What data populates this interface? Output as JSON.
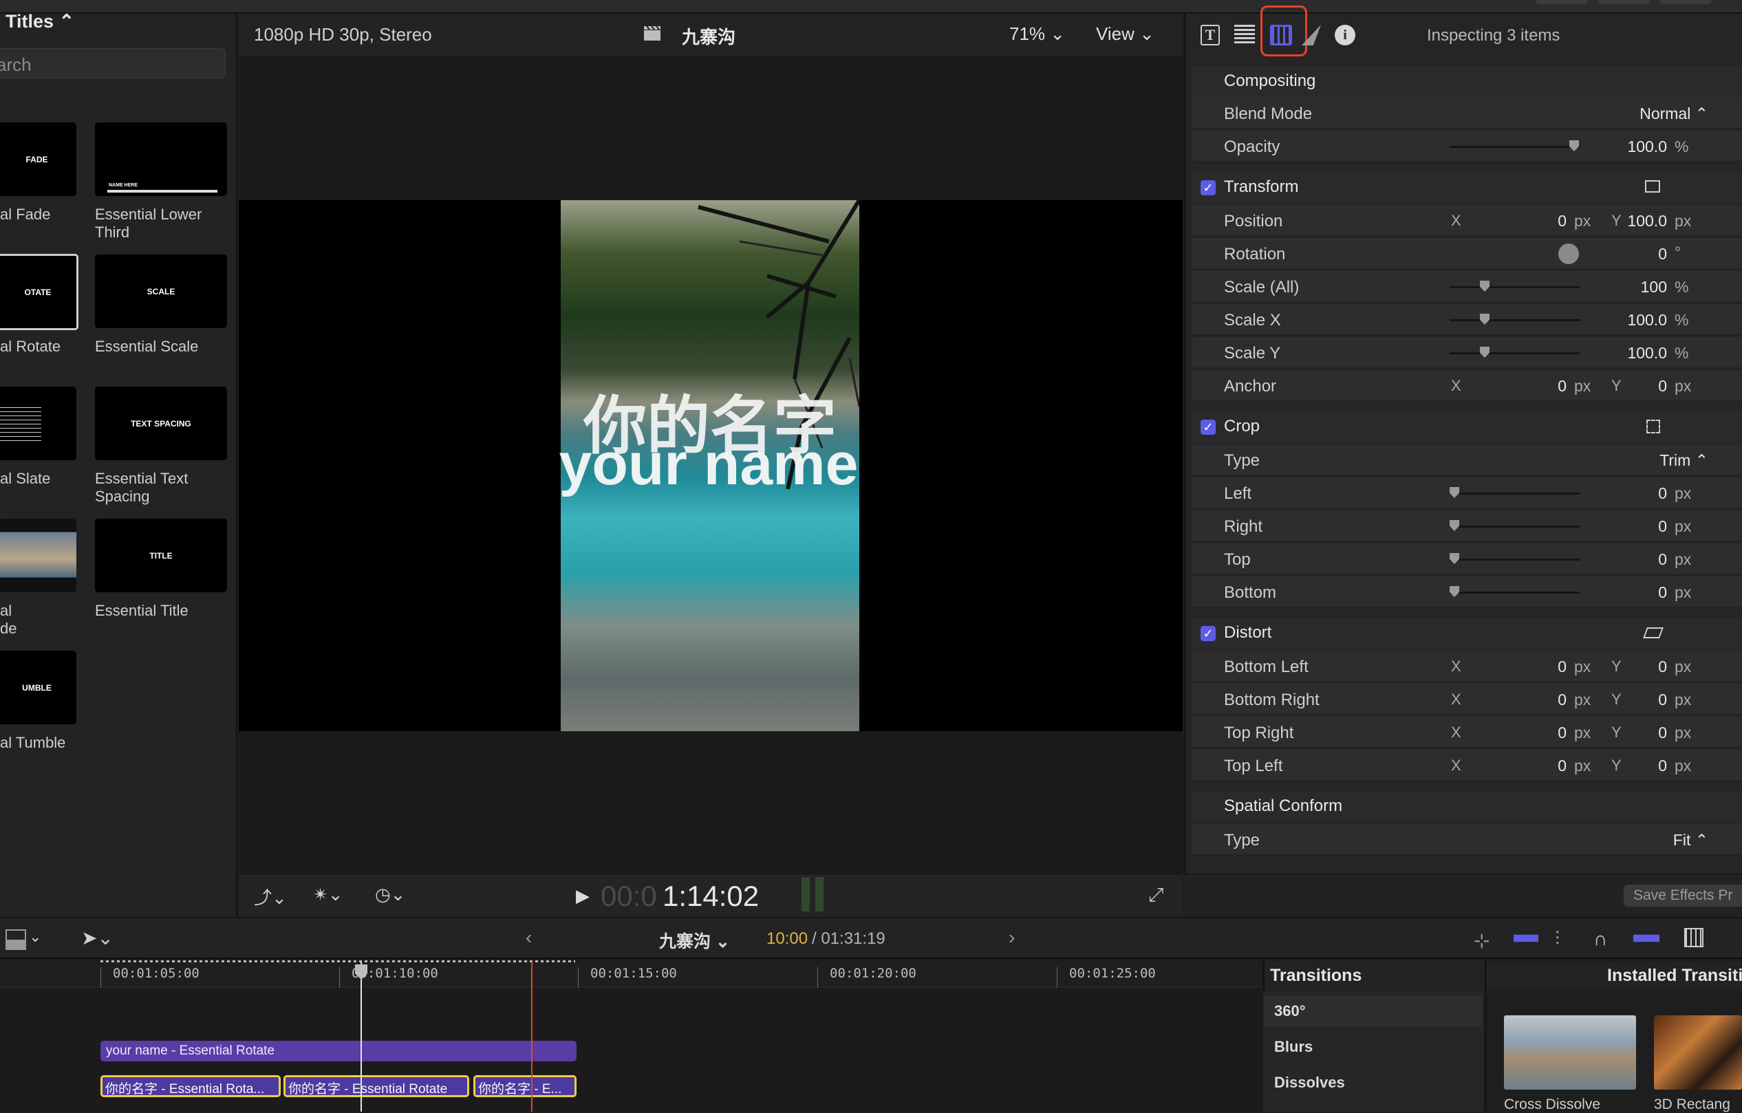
{
  "browser": {
    "title": "Titles ⌃",
    "search_placeholder": "arch",
    "items": [
      {
        "thumb": "FADE",
        "label": "al Fade"
      },
      {
        "thumb": "NAME HERE",
        "label": "Essential Lower Third"
      },
      {
        "thumb": "OTATE",
        "label": "al Rotate"
      },
      {
        "thumb": "SCALE",
        "label": "Essential Scale"
      },
      {
        "thumb": "",
        "label": "al Slate"
      },
      {
        "thumb": "TEXT SPACING",
        "label": "Essential Text Spacing"
      },
      {
        "thumb": "",
        "label": "al de"
      },
      {
        "thumb": "TITLE",
        "label": "Essential Title"
      },
      {
        "thumb": "UMBLE",
        "label": "al Tumble"
      }
    ]
  },
  "viewer": {
    "format": "1080p HD 30p, Stereo",
    "project": "九寨沟",
    "zoom": "71% ⌄",
    "view": "View ⌄",
    "title_cn": "你的名字",
    "title_en": "your name",
    "timecode_dim": "00:0",
    "timecode": "1:14:02"
  },
  "inspector": {
    "header": "Inspecting 3 items",
    "compositing": {
      "title": "Compositing",
      "blend_label": "Blend Mode",
      "blend_value": "Normal ⌃",
      "opacity_label": "Opacity",
      "opacity_value": "100.0",
      "opacity_unit": "%"
    },
    "transform": {
      "title": "Transform",
      "position": {
        "label": "Position",
        "x": "0",
        "y": "100.0"
      },
      "rotation": {
        "label": "Rotation",
        "value": "0",
        "unit": "°"
      },
      "scale_all": {
        "label": "Scale (All)",
        "value": "100"
      },
      "scale_x": {
        "label": "Scale X",
        "value": "100.0"
      },
      "scale_y": {
        "label": "Scale Y",
        "value": "100.0"
      },
      "anchor": {
        "label": "Anchor",
        "x": "0",
        "y": "0"
      }
    },
    "crop": {
      "title": "Crop",
      "type_label": "Type",
      "type_value": "Trim ⌃",
      "left": {
        "label": "Left",
        "value": "0"
      },
      "right": {
        "label": "Right",
        "value": "0"
      },
      "top": {
        "label": "Top",
        "value": "0"
      },
      "bottom": {
        "label": "Bottom",
        "value": "0"
      }
    },
    "distort": {
      "title": "Distort",
      "rows": [
        {
          "label": "Bottom Left",
          "x": "0",
          "y": "0"
        },
        {
          "label": "Bottom Right",
          "x": "0",
          "y": "0"
        },
        {
          "label": "Top Right",
          "x": "0",
          "y": "0"
        },
        {
          "label": "Top Left",
          "x": "0",
          "y": "0"
        }
      ]
    },
    "spatial": {
      "title": "Spatial Conform",
      "type_label": "Type",
      "type_value": "Fit ⌃"
    },
    "save_button": "Save Effects Pr",
    "px": "px",
    "pct": "%",
    "x_axis": "X",
    "y_axis": "Y"
  },
  "timeline": {
    "project": "九寨沟 ⌄",
    "time_current": "10:00",
    "time_total": "/ 01:31:19",
    "ruler": [
      "00:01:05:00",
      "00:01:10:00",
      "00:01:15:00",
      "00:01:20:00",
      "00:01:25:00"
    ],
    "clip_main": "your name - Essential Rotate",
    "clips": [
      "你的名字 - Essential Rota...",
      "你的名字 - Essential Rotate",
      "你的名字 - E..."
    ]
  },
  "transitions": {
    "title": "Transitions",
    "installed": "Installed Transiti",
    "categories": [
      "360°",
      "Blurs",
      "Dissolves"
    ],
    "thumbs": [
      "Cross Dissolve",
      "3D Rectang"
    ]
  },
  "colors": {
    "accent": "#5e5ce6",
    "selection_highlight": "#e8412c",
    "clip_yellow": "#f3cf3c"
  }
}
